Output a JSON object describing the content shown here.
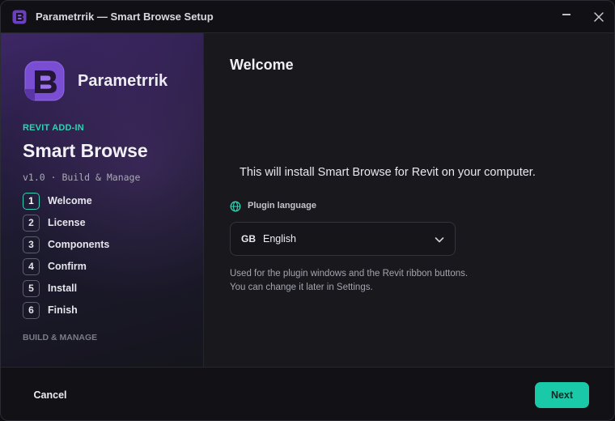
{
  "window": {
    "title": "Parametrrik — Smart Browse Setup"
  },
  "sidebar": {
    "brand_name": "Parametrrik",
    "addin_tag": "REVIT ADD-IN",
    "product_name": "Smart Browse",
    "version_line": "v1.0 · Build & Manage",
    "steps": [
      {
        "number": "1",
        "label": "Welcome",
        "active": true
      },
      {
        "number": "2",
        "label": "License",
        "active": false
      },
      {
        "number": "3",
        "label": "Components",
        "active": false
      },
      {
        "number": "4",
        "label": "Confirm",
        "active": false
      },
      {
        "number": "5",
        "label": "Install",
        "active": false
      },
      {
        "number": "6",
        "label": "Finish",
        "active": false
      }
    ],
    "footer": "BUILD & MANAGE"
  },
  "main": {
    "title": "Welcome",
    "intro": "This will install Smart Browse for Revit on your computer.",
    "language": {
      "label": "Plugin language",
      "flag_code": "GB",
      "selected": "English",
      "help": "Used for the plugin windows and the Revit ribbon buttons. You can change it later in Settings."
    }
  },
  "footer": {
    "cancel_label": "Cancel",
    "next_label": "Next"
  },
  "colors": {
    "accent": "#19c9a7",
    "brand_purple": "#7b4fd0",
    "background": "#18181d"
  },
  "icons": [
    "app-logo-icon",
    "minimize-icon",
    "close-icon",
    "globe-icon",
    "chevron-down-icon"
  ]
}
